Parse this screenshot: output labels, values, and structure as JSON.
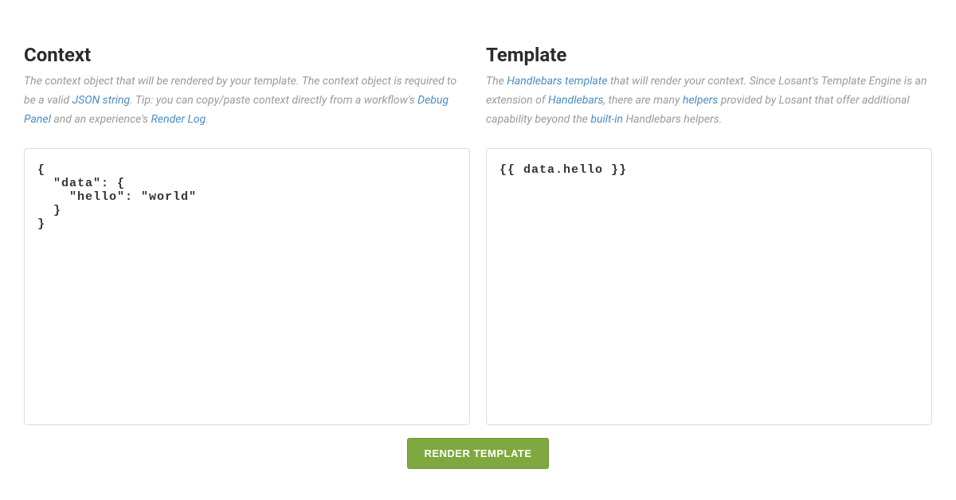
{
  "context": {
    "title": "Context",
    "desc": {
      "part1": "The context object that will be rendered by your template. The context object is required to be a valid ",
      "link1": "JSON string",
      "part2": ". Tip: you can copy/paste context directly from a workflow's ",
      "link2": "Debug Panel",
      "part3": " and an experience's ",
      "link3": "Render Log",
      "part4": "."
    },
    "code": "{\n  \"data\": {\n    \"hello\": \"world\"\n  }\n}"
  },
  "template": {
    "title": "Template",
    "desc": {
      "part1": "The ",
      "link1": "Handlebars template",
      "part2": " that will render your context. Since Losant's Template Engine is an extension of ",
      "link2": "Handlebars",
      "part3": ", there are many ",
      "link3": "helpers",
      "part4": " provided by Losant that offer additional capability beyond the ",
      "link4": "built-in",
      "part5": " Handlebars helpers."
    },
    "code": "{{ data.hello }}"
  },
  "button": {
    "label": "RENDER TEMPLATE"
  }
}
